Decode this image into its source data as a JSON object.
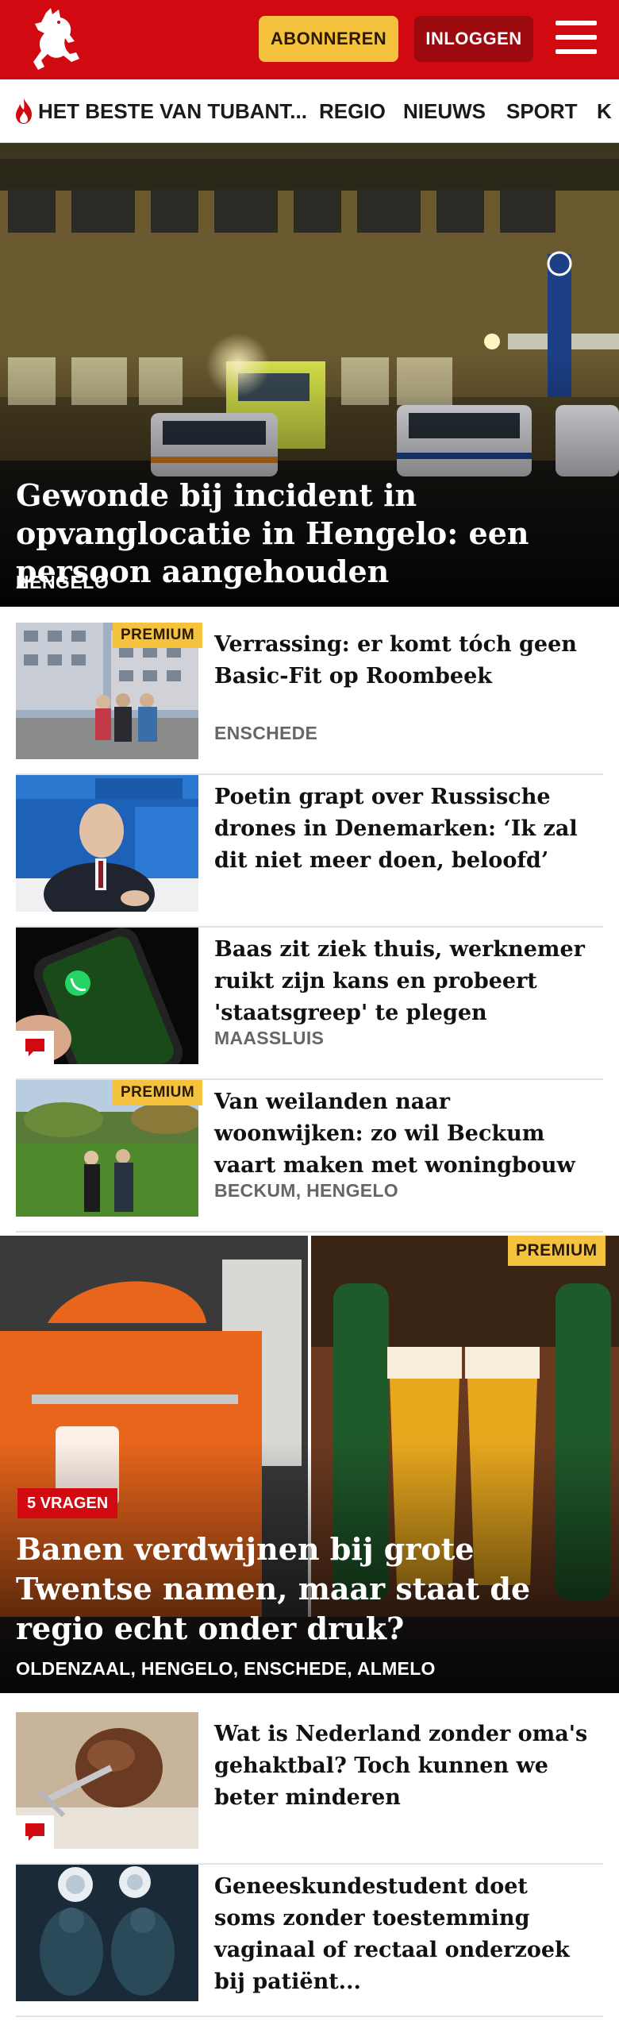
{
  "header": {
    "subscribe_label": "ABONNEREN",
    "login_label": "INLOGGEN",
    "brand_color": "#d10a11",
    "accent_color": "#f5c23d"
  },
  "nav": {
    "items": [
      {
        "label": "HET BESTE VAN TUBANT..."
      },
      {
        "label": "REGIO"
      },
      {
        "label": "NIEUWS"
      },
      {
        "label": "SPORT"
      },
      {
        "label": "K"
      }
    ]
  },
  "hero": {
    "title": "Gewonde bij incident in opvanglocatie in Hengelo: een persoon aangehouden",
    "location": "HENGELO"
  },
  "articles": [
    {
      "title": "Verrassing: er komt tóch geen Basic-Fit op Roombeek",
      "location": "ENSCHEDE",
      "badge": "PREMIUM"
    },
    {
      "title": "Poetin grapt over Russische drones in Denemarken: ‘Ik zal dit niet meer doen, beloofd’",
      "location": ""
    },
    {
      "title": "Baas zit ziek thuis, werknemer ruikt zijn kans en probeert 'staatsgreep' te plegen",
      "location": "MAASSLUIS"
    },
    {
      "title": "Van weilanden naar woonwijken: zo wil Beckum vaart maken met woningbouw",
      "location": "BECKUM, HENGELO",
      "badge": "PREMIUM"
    }
  ],
  "feature": {
    "badge": "PREMIUM",
    "tag": "5 VRAGEN",
    "title": "Banen verdwijnen bij grote Twentse namen, maar staat de regio echt onder druk?",
    "location": "OLDENZAAL, HENGELO, ENSCHEDE, ALMELO"
  },
  "articles2": [
    {
      "title": "Wat is Nederland zonder oma's gehaktbal? Toch kunnen we beter minderen"
    },
    {
      "title": "Geneeskundestudent doet soms zonder toestemming vaginaal of rectaal onderzoek bij patiënt..."
    }
  ],
  "icons": {
    "logo": "tubantia-horse-logo",
    "menu": "hamburger-menu-icon",
    "nav_fire": "fire-icon",
    "comment": "comment-icon"
  }
}
